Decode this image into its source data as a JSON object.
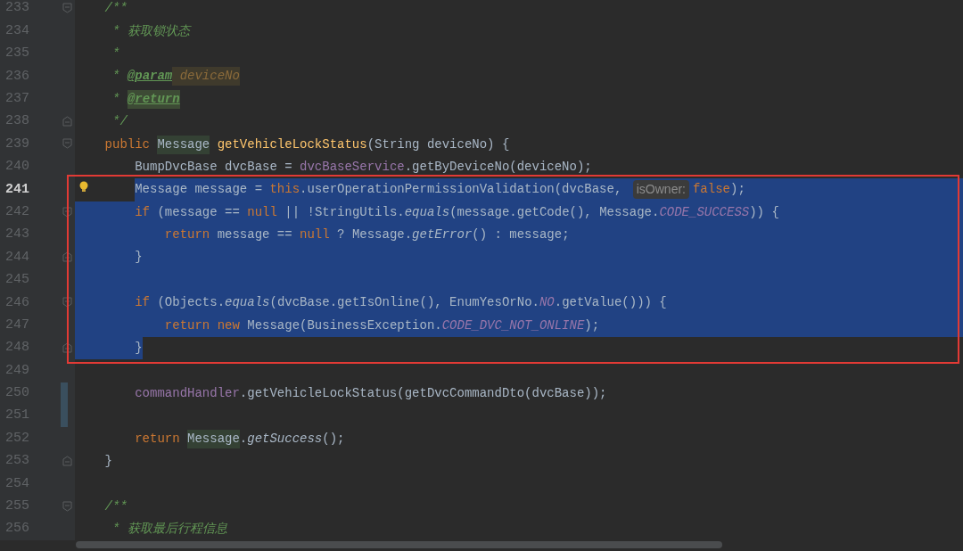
{
  "editor": {
    "lines": [
      {
        "number": "233",
        "current": false,
        "selected": false,
        "fold_start": true,
        "tokens": [
          {
            "text": "    /**",
            "kind": "doc"
          }
        ]
      },
      {
        "number": "234",
        "current": false,
        "selected": false,
        "tokens": [
          {
            "text": "     * 获取锁状态",
            "kind": "doc"
          }
        ]
      },
      {
        "number": "235",
        "current": false,
        "selected": false,
        "tokens": [
          {
            "text": "     *",
            "kind": "doc"
          }
        ]
      },
      {
        "number": "236",
        "current": false,
        "selected": false,
        "tokens": [
          {
            "text": "     * ",
            "kind": "doc"
          },
          {
            "text": "@param",
            "kind": "doc_tag"
          },
          {
            "text": " deviceNo",
            "kind": "param_ref"
          }
        ]
      },
      {
        "number": "237",
        "current": false,
        "selected": false,
        "tokens": [
          {
            "text": "     * ",
            "kind": "doc"
          },
          {
            "text": "@return",
            "kind": "doc_tag_marked"
          }
        ]
      },
      {
        "number": "238",
        "current": false,
        "selected": false,
        "fold_end": true,
        "tokens": [
          {
            "text": "     */",
            "kind": "doc"
          }
        ]
      },
      {
        "number": "239",
        "current": false,
        "selected": false,
        "fold_start": true,
        "tokens": [
          {
            "text": "    public ",
            "kind": "keyword"
          },
          {
            "text": "Message",
            "kind": "usage"
          },
          {
            "text": " getVehicleLockStatus",
            "kind": "method_decl"
          },
          {
            "text": "(String deviceNo) {",
            "kind": "plain"
          }
        ]
      },
      {
        "number": "240",
        "current": false,
        "selected": false,
        "tokens": [
          {
            "text": "        BumpDvcBase dvcBase = ",
            "kind": "plain"
          },
          {
            "text": "dvcBaseService",
            "kind": "field"
          },
          {
            "text": ".getByDeviceNo(deviceNo);",
            "kind": "plain"
          }
        ]
      },
      {
        "number": "241",
        "current": true,
        "selected": true,
        "bulb": true,
        "selection_from_text": true,
        "tokens": [
          {
            "text": "        Message message = ",
            "kind": "plain"
          },
          {
            "text": "this",
            "kind": "keyword"
          },
          {
            "text": ".userOperationPermissionValidation(dvcBase, ",
            "kind": "plain"
          },
          {
            "text": "isOwner:",
            "kind": "hint"
          },
          {
            "text": "false",
            "kind": "keyword"
          },
          {
            "text": ");",
            "kind": "plain"
          }
        ]
      },
      {
        "number": "242",
        "current": false,
        "selected": true,
        "fold_start": true,
        "tokens": [
          {
            "text": "        if ",
            "kind": "keyword"
          },
          {
            "text": "(message == ",
            "kind": "plain"
          },
          {
            "text": "null",
            "kind": "keyword"
          },
          {
            "text": " || !StringUtils.",
            "kind": "plain"
          },
          {
            "text": "equals",
            "kind": "static"
          },
          {
            "text": "(message.getCode(), Message.",
            "kind": "plain"
          },
          {
            "text": "CODE_SUCCESS",
            "kind": "constant"
          },
          {
            "text": ")) {",
            "kind": "plain"
          }
        ]
      },
      {
        "number": "243",
        "current": false,
        "selected": true,
        "tokens": [
          {
            "text": "            return ",
            "kind": "keyword"
          },
          {
            "text": "message == ",
            "kind": "plain"
          },
          {
            "text": "null",
            "kind": "keyword"
          },
          {
            "text": " ? Message.",
            "kind": "plain"
          },
          {
            "text": "getError",
            "kind": "static"
          },
          {
            "text": "() : message;",
            "kind": "plain"
          }
        ]
      },
      {
        "number": "244",
        "current": false,
        "selected": true,
        "fold_end": true,
        "tokens": [
          {
            "text": "        }",
            "kind": "plain"
          }
        ]
      },
      {
        "number": "245",
        "current": false,
        "selected": true
      },
      {
        "number": "246",
        "current": false,
        "selected": true,
        "fold_start": true,
        "tokens": [
          {
            "text": "        if ",
            "kind": "keyword"
          },
          {
            "text": "(Objects.",
            "kind": "plain"
          },
          {
            "text": "equals",
            "kind": "static"
          },
          {
            "text": "(dvcBase.getIsOnline(), EnumYesOrNo.",
            "kind": "plain"
          },
          {
            "text": "NO",
            "kind": "constant"
          },
          {
            "text": ".getValue())) {",
            "kind": "plain"
          }
        ]
      },
      {
        "number": "247",
        "current": false,
        "selected": true,
        "tokens": [
          {
            "text": "            return new ",
            "kind": "keyword"
          },
          {
            "text": "Message(BusinessException.",
            "kind": "plain"
          },
          {
            "text": "CODE_DVC_NOT_ONLINE",
            "kind": "constant"
          },
          {
            "text": ");",
            "kind": "plain"
          }
        ]
      },
      {
        "number": "248",
        "current": false,
        "selected": true,
        "fold_end": true,
        "selection_to_text": true,
        "tokens": [
          {
            "text": "        }",
            "kind": "plain"
          }
        ]
      },
      {
        "number": "249",
        "current": false,
        "selected": false
      },
      {
        "number": "250",
        "current": false,
        "selected": false,
        "changed": true,
        "tokens": [
          {
            "text": "        commandHandler",
            "kind": "field"
          },
          {
            "text": ".getVehicleLockStatus(getDvcCommandDto(dvcBase));",
            "kind": "plain"
          }
        ]
      },
      {
        "number": "251",
        "current": false,
        "selected": false,
        "changed": true
      },
      {
        "number": "252",
        "current": false,
        "selected": false,
        "tokens": [
          {
            "text": "        return ",
            "kind": "keyword"
          },
          {
            "text": "Message",
            "kind": "usage"
          },
          {
            "text": ".",
            "kind": "plain"
          },
          {
            "text": "getSuccess",
            "kind": "static"
          },
          {
            "text": "();",
            "kind": "plain"
          }
        ]
      },
      {
        "number": "253",
        "current": false,
        "selected": false,
        "fold_end": true,
        "tokens": [
          {
            "text": "    }",
            "kind": "plain"
          }
        ]
      },
      {
        "number": "254",
        "current": false,
        "selected": false
      },
      {
        "number": "255",
        "current": false,
        "selected": false,
        "fold_start": true,
        "tokens": [
          {
            "text": "    /**",
            "kind": "doc"
          }
        ]
      },
      {
        "number": "256",
        "current": false,
        "selected": false,
        "tokens": [
          {
            "text": "     * 获取最后行程信息",
            "kind": "doc"
          }
        ]
      }
    ]
  }
}
